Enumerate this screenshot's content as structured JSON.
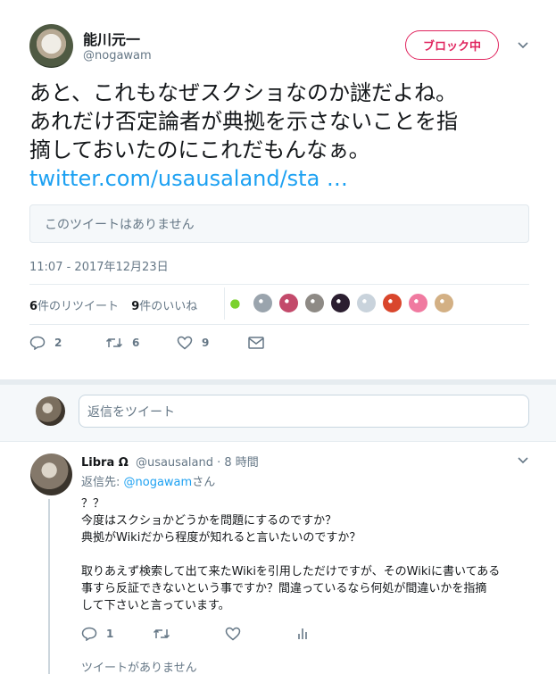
{
  "tweet": {
    "author_name": "能川元一",
    "author_handle": "@nogawam",
    "block_button": "ブロック中",
    "text_lines": [
      "あと、これもなぜスクショなのか謎だよね。",
      "あれだけ否定論者が典拠を示さないことを指",
      "摘しておいたのにこれだもんなぁ。"
    ],
    "link_text": "twitter.com/usausaland/sta …",
    "quote_unavailable": "このツイートはありません",
    "timestamp": "11:07 - 2017年12月23日",
    "retweet_count": "6",
    "retweet_label": "件のリツイート",
    "like_count": "9",
    "like_label": "件のいいね",
    "action_reply_count": "2",
    "action_retweet_count": "6",
    "action_like_count": "9",
    "liker_colors": [
      "#ffffff",
      "#9aa4ad",
      "#c34a6b",
      "#8e8a85",
      "#2b1e30",
      "#c9d3dc",
      "#d9462c",
      "#f07aa0",
      "#d3b084"
    ]
  },
  "compose": {
    "placeholder": "返信をツイート"
  },
  "reply": {
    "author_name": "Libra Ω",
    "author_handle": "@usausaland",
    "time": "· 8 時間",
    "reply_to_prefix": "返信先: ",
    "reply_to_mention": "@nogawam",
    "reply_to_suffix": "さん",
    "body_lines": [
      "？？",
      "今度はスクショかどうかを問題にするのですか？",
      "典拠がWikiだから程度が知れると言いたいのですか？",
      "",
      "取りあえず検索して出て来たWikiを引用しただけですが、そのWikiに書いてある",
      "事すら反証できないという事ですか？間違っているなら何処が間違いかを指摘",
      "して下さいと言っています。"
    ],
    "reply_count": "1",
    "more_replies": "ツイートがありません"
  },
  "colors": {
    "link": "#1da1f2",
    "block": "#e0245e",
    "muted": "#657786"
  }
}
